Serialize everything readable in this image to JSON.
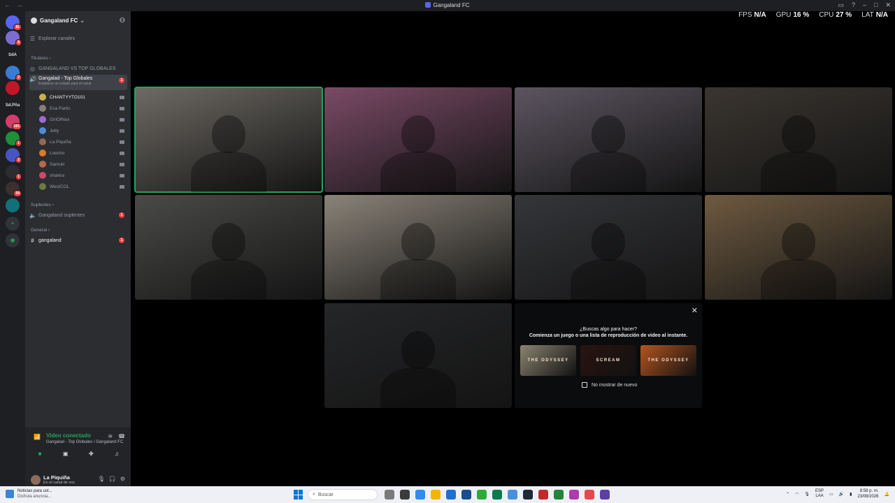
{
  "window": {
    "title": "Gangaland FC"
  },
  "stats": {
    "fps_label": "FPS",
    "fps_value": "N/A",
    "gpu_label": "GPU",
    "gpu_value": "16 %",
    "cpu_label": "CPU",
    "cpu_value": "27 %",
    "lat_label": "LAT",
    "lat_value": "N/A"
  },
  "rail": {
    "servers": [
      {
        "badge": "81",
        "color": "#5865f2"
      },
      {
        "badge": "8",
        "color": "#7d6bd4"
      },
      {
        "label": "SdA",
        "color": "#1e1f22"
      },
      {
        "badge": "2",
        "color": "#3a7bd5"
      },
      {
        "badge": "",
        "color": "#c0172b"
      },
      {
        "label": "Sd.Pña",
        "color": "#1e1f22"
      },
      {
        "badge": "191",
        "color": "#d63c6a"
      },
      {
        "badge": "1",
        "color": "#1f8f3a"
      },
      {
        "badge": "2",
        "color": "#4954c4"
      },
      {
        "badge": "1",
        "color": "#2b2d31"
      },
      {
        "badge": "54",
        "color": "#3b2f2f"
      },
      {
        "badge": "",
        "color": "#12707a"
      }
    ]
  },
  "sidebar": {
    "guild_name": "Gangaland FC",
    "explore": "Explorar canales",
    "cat_titulares": "Titulares",
    "ch_vs": "GANGALAND VS TOP GLOBALES",
    "ch_active": "Gangalad - Top Globales",
    "ch_active_status": "Establece un estado para el canal",
    "ch_active_count": "1",
    "members": [
      {
        "name": "CHANTYYTO101",
        "color": "#c9b24b",
        "active": true
      },
      {
        "name": "Eva Partic",
        "color": "#8b7f7a"
      },
      {
        "name": "GirlOfNox",
        "color": "#9b6bd4"
      },
      {
        "name": "Jelty",
        "color": "#4d8bd9"
      },
      {
        "name": "La Piquiña",
        "color": "#8e6b57"
      },
      {
        "name": "Loecho",
        "color": "#d97a2c"
      },
      {
        "name": "Samulx",
        "color": "#b36b4b"
      },
      {
        "name": "shakira",
        "color": "#c74b6b"
      },
      {
        "name": "WestCOL",
        "color": "#6b7a4b"
      }
    ],
    "cat_suplentes": "Suplentes",
    "ch_suplentes": "Gangaland suplentes",
    "ch_suplentes_count": "1",
    "cat_general": "General",
    "ch_general": "gangaland",
    "ch_general_count": "1"
  },
  "voice": {
    "status": "Video conectado",
    "channel": "Gangalad - Top Globales / Gangaland FC"
  },
  "user": {
    "name": "La Piquiña",
    "status": "En el canal de voz"
  },
  "tiles": [
    {
      "bg": "#6e6a64",
      "speaking": true
    },
    {
      "bg": "#7a4a66"
    },
    {
      "bg": "#5c5560"
    },
    {
      "bg": "#3a3530"
    },
    {
      "bg": "#4a4a48"
    },
    {
      "bg": "#8a8378"
    },
    {
      "bg": "#35363a"
    },
    {
      "bg": "#6e5a40"
    },
    {
      "bg": "#252628"
    }
  ],
  "activity": {
    "question": "¿Buscas algo para hacer?",
    "subtitle": "Comienza un juego o una lista de reproducción de video al instante.",
    "cards": [
      {
        "label": "THE ODYSSEY",
        "bg": "#8c8470"
      },
      {
        "label": "SCREAM",
        "bg": "#2a1410"
      },
      {
        "label": "THE ODYSSEY",
        "bg": "#b4551f"
      }
    ],
    "dont_show": "No mostrar de nuevo"
  },
  "taskbar": {
    "news_title": "Noticias para ust...",
    "news_sub": "Disfruta anuncia...",
    "search_placeholder": "Buscar",
    "lang": "ESP",
    "lang_sub": "LAA",
    "time": "8:58 p. m.",
    "date": "23/08/2026"
  }
}
